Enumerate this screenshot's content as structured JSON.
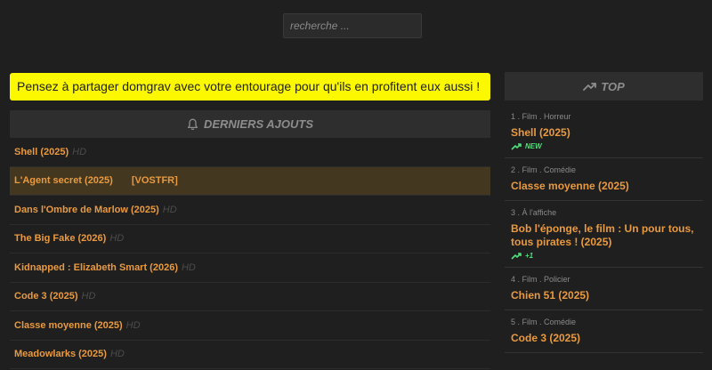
{
  "search": {
    "placeholder": "recherche ..."
  },
  "banner": {
    "text": "Pensez à partager domgrav avec votre entourage pour qu'ils en profitent eux aussi !"
  },
  "latest": {
    "title": "DERNIERS AJOUTS",
    "icon": "bell-icon",
    "items": [
      {
        "title": "Shell (2025)",
        "quality": "HD"
      },
      {
        "title": "L'Agent secret (2025)",
        "tag": "[VOSTFR]"
      },
      {
        "title": "Dans l'Ombre de Marlow (2025)",
        "quality": "HD"
      },
      {
        "title": "The Big Fake (2026)",
        "quality": "HD"
      },
      {
        "title": "Kidnapped : Elizabeth Smart (2026)",
        "quality": "HD"
      },
      {
        "title": "Code 3 (2025)",
        "quality": "HD"
      },
      {
        "title": "Classe moyenne (2025)",
        "quality": "HD"
      },
      {
        "title": "Meadowlarks (2025)",
        "quality": "HD"
      }
    ]
  },
  "top": {
    "title": "TOP",
    "icon": "trending-up-icon",
    "items": [
      {
        "rank": "1 . Film . Horreur",
        "title": "Shell (2025)",
        "trend": "NEW"
      },
      {
        "rank": "2 . Film . Comédie",
        "title": "Classe moyenne (2025)"
      },
      {
        "rank": "3 . À l'affiche",
        "title": "Bob l'éponge, le film : Un pour tous, tous pirates ! (2025)",
        "trend": "+1"
      },
      {
        "rank": "4 . Film . Policier",
        "title": "Chien 51 (2025)"
      },
      {
        "rank": "5 . Film . Comédie",
        "title": "Code 3 (2025)"
      }
    ]
  },
  "colors": {
    "accent": "#e99a3f",
    "banner_bg": "#fbf800",
    "trend": "#4ee07a",
    "highlight_row": "#43371f"
  }
}
